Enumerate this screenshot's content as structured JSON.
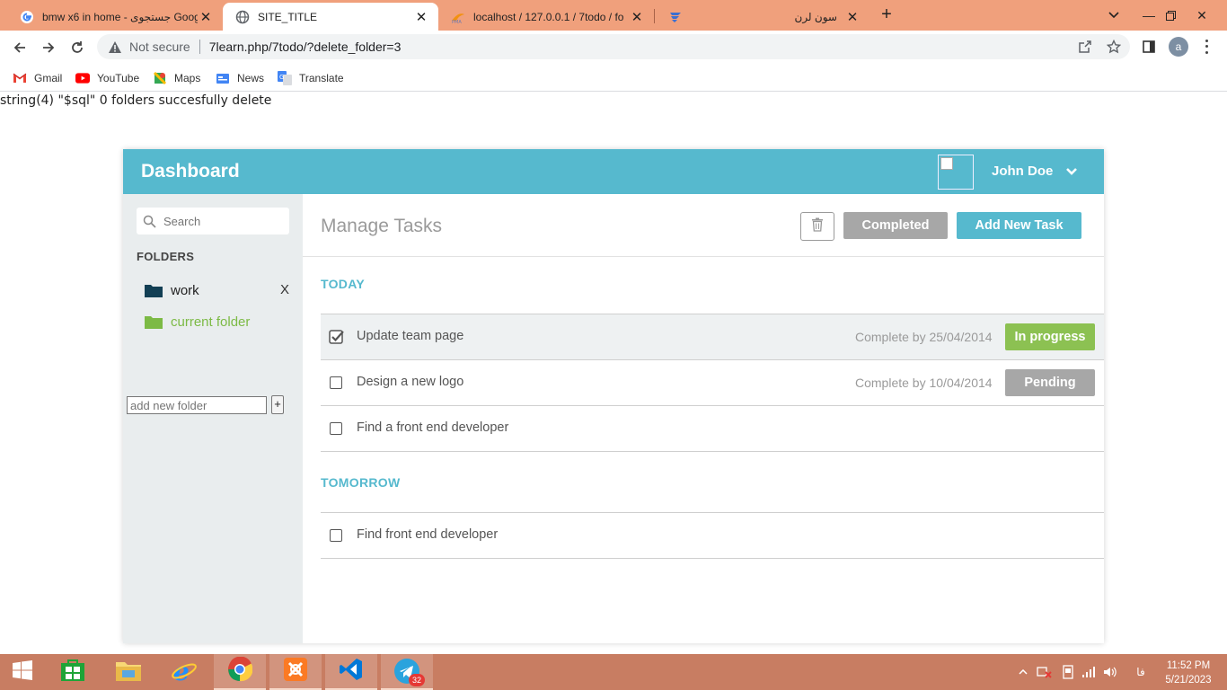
{
  "browser": {
    "tabs": [
      {
        "title": "bmw x6 in home - جستجوی Goog",
        "active": false
      },
      {
        "title": "SITE_TITLE",
        "active": true
      },
      {
        "title": "localhost / 127.0.0.1 / 7todo / fo",
        "active": false
      },
      {
        "title": "سون لرن",
        "active": false
      }
    ],
    "address": {
      "security_label": "Not secure",
      "url": "7learn.php/7todo/?delete_folder=3"
    },
    "profile_initial": "a",
    "bookmarks": [
      "Gmail",
      "YouTube",
      "Maps",
      "News",
      "Translate"
    ]
  },
  "page": {
    "debug_output": "string(4) \"$sql\" 0 folders succesfully delete"
  },
  "app": {
    "title": "Dashboard",
    "user_name": "John Doe",
    "sidebar": {
      "search_placeholder": "Search",
      "folders_title": "FOLDERS",
      "folders": [
        {
          "name": "work",
          "delete_label": "X",
          "color": "#123f54"
        },
        {
          "name": "current folder",
          "color": "#7cba45"
        }
      ],
      "add_folder_placeholder": "add new folder",
      "add_folder_button": "+"
    },
    "main": {
      "title": "Manage Tasks",
      "completed_button": "Completed",
      "add_task_button": "Add New Task",
      "sections": [
        {
          "title": "TODAY",
          "tasks": [
            {
              "name": "Update team page",
              "checked": true,
              "due": "Complete by 25/04/2014",
              "status": "In progress",
              "status_color": "#8cc152"
            },
            {
              "name": "Design a new logo",
              "checked": false,
              "due": "Complete by 10/04/2014",
              "status": "Pending",
              "status_color": "#a7a7a7"
            },
            {
              "name": "Find a front end developer",
              "checked": false
            }
          ]
        },
        {
          "title": "TOMORROW",
          "tasks": [
            {
              "name": "Find front end developer",
              "checked": false
            }
          ]
        }
      ]
    },
    "colors": {
      "accent": "#56b9ce",
      "sidebar_bg": "#e9edee",
      "completed_btn": "#a7a7a7"
    }
  },
  "taskbar": {
    "apps": [
      "start",
      "store",
      "file-explorer",
      "internet-explorer",
      "chrome",
      "xampp",
      "vscode",
      "telegram"
    ],
    "telegram_badge": "32",
    "language": "فا",
    "time": "11:52 PM",
    "date": "5/21/2023",
    "color": "#c87d62"
  }
}
